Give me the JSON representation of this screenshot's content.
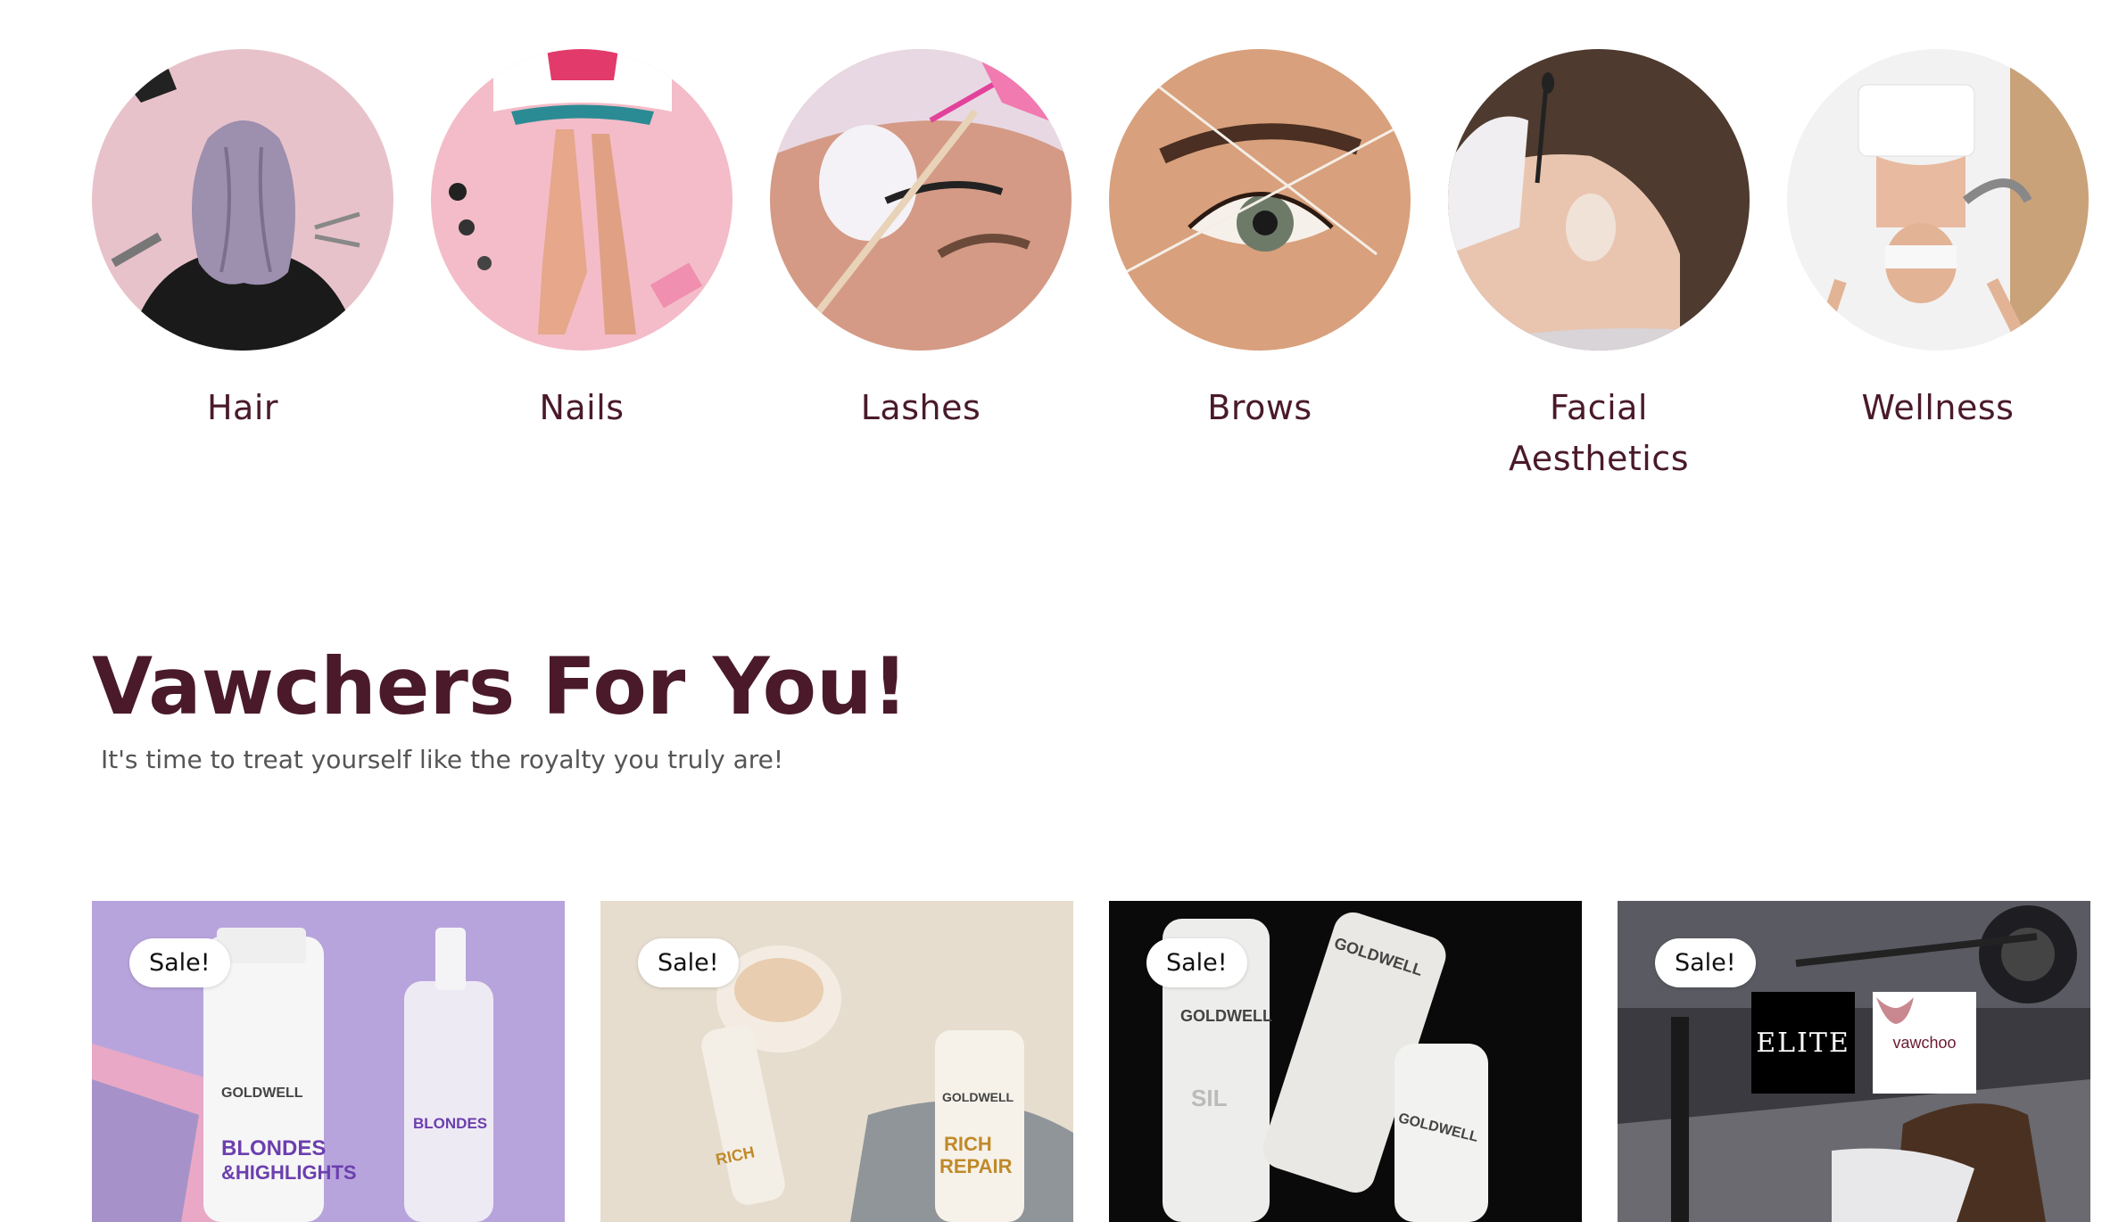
{
  "categories": [
    {
      "label": "Hair",
      "icon": "hair-photo"
    },
    {
      "label": "Nails",
      "icon": "nails-photo"
    },
    {
      "label": "Lashes",
      "icon": "lashes-photo"
    },
    {
      "label": "Brows",
      "icon": "brows-photo"
    },
    {
      "label": "Facial Aesthetics",
      "icon": "facial-photo"
    },
    {
      "label": "Wellness",
      "icon": "wellness-photo"
    }
  ],
  "section": {
    "title": "Vawchers For You!",
    "subtitle": "It's time to treat yourself like the royalty you truly are!"
  },
  "vouchers": [
    {
      "badge": "Sale!",
      "product": "Blondes & Highlights"
    },
    {
      "badge": "Sale!",
      "product": "Rich Repair"
    },
    {
      "badge": "Sale!",
      "product": "Silver"
    },
    {
      "badge": "Sale!",
      "brand_logo": "ELITE",
      "partner_logo": "vawchoo"
    }
  ],
  "colors": {
    "heading": "#4a1a2a",
    "subtitle": "#555555",
    "badge_bg": "#ffffff"
  }
}
